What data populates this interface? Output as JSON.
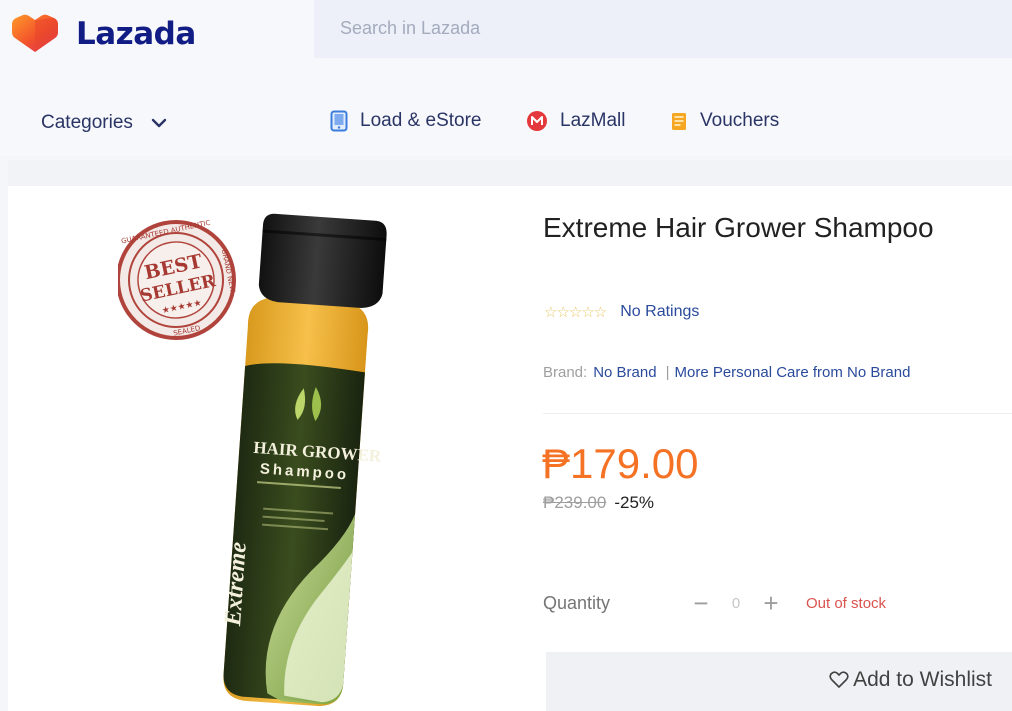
{
  "header": {
    "logo_text": "Lazada",
    "search_placeholder": "Search in Lazada"
  },
  "nav": {
    "categories_label": "Categories",
    "items": [
      {
        "label": "Load & eStore",
        "icon": "phone-icon"
      },
      {
        "label": "LazMall",
        "icon": "lazmall-icon"
      },
      {
        "label": "Vouchers",
        "icon": "voucher-icon"
      }
    ]
  },
  "product": {
    "title": "Extreme Hair Grower Shampoo",
    "stars": "☆☆☆☆☆",
    "rating_text": "No Ratings",
    "brand_label": "Brand:",
    "brand_name": "No Brand",
    "brand_separator": "|",
    "brand_more": "More Personal Care from No Brand",
    "price": "₱179.00",
    "original_price": "₱239.00",
    "discount": "-25%",
    "quantity_label": "Quantity",
    "quantity_minus": "−",
    "quantity_value": "0",
    "quantity_plus": "+",
    "stock_status": "Out of stock",
    "wishlist_label": "Add to Wishlist"
  },
  "image_text": {
    "seal_top": "GUARANTEED AUTHENTIC",
    "seal_bottom": "SEALED",
    "seal_side": "BRAND NEW",
    "seal_line1": "BEST",
    "seal_line2": "SELLER",
    "seal_stars": "★★★★★",
    "bottle_line1": "HAIR GROWER",
    "bottle_line2": "Shampoo",
    "bottle_brand": "Extreme"
  },
  "colors": {
    "accent_orange": "#f57224",
    "brand_navy": "#111c85",
    "link_blue": "#2a4a9c"
  }
}
